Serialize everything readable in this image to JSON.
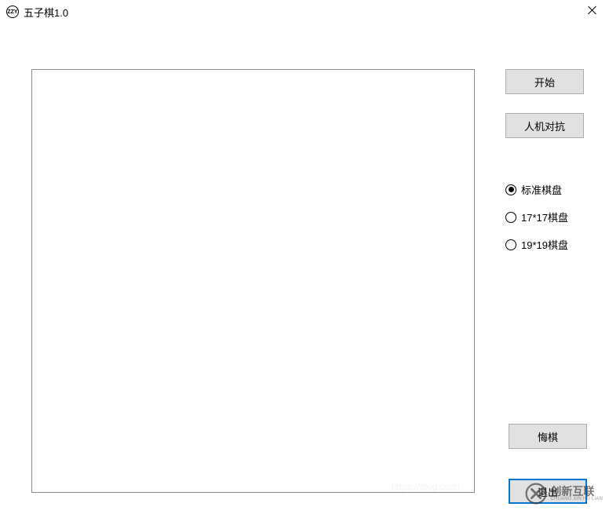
{
  "window": {
    "title": "五子棋1.0"
  },
  "buttons": {
    "start": "开始",
    "mode": "人机对抗",
    "undo": "悔棋",
    "exit": "退出"
  },
  "board_options": [
    {
      "label": "标准棋盘",
      "checked": true
    },
    {
      "label": "17*17棋盘",
      "checked": false
    },
    {
      "label": "19*19棋盘",
      "checked": false
    }
  ],
  "watermark": {
    "cn": "创新互联",
    "en": "CHUANG XIN HU LIAN"
  },
  "faint_url": "https://blog.csdn"
}
